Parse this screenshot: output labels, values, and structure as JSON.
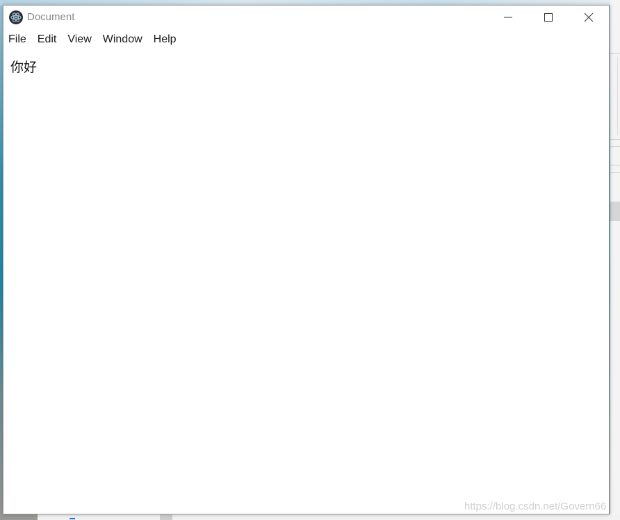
{
  "window": {
    "title": "Document",
    "app_icon": "electron-atom-icon"
  },
  "controls": {
    "minimize_icon": "minimize-icon",
    "maximize_icon": "maximize-icon",
    "close_icon": "close-icon"
  },
  "menu": {
    "items": [
      "File",
      "Edit",
      "View",
      "Window",
      "Help"
    ]
  },
  "document": {
    "content": "你好"
  },
  "watermark": "https://blog.csdn.net/Govern66",
  "colors": {
    "title_text": "#8a8a8a",
    "window_bg": "#ffffff",
    "icon_bg": "#2b2f3a"
  }
}
